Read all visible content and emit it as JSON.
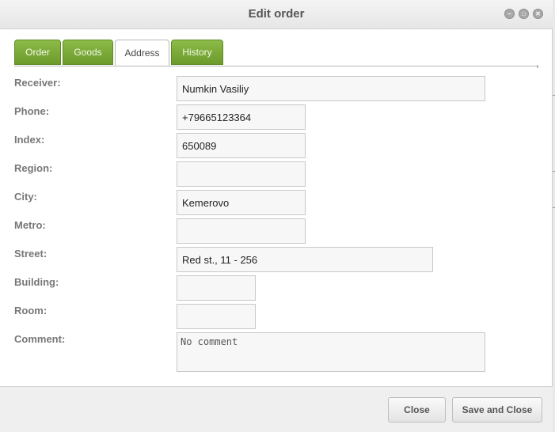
{
  "dialog": {
    "title": "Edit order",
    "window_buttons": {
      "minimize": "–",
      "maximize": "□",
      "close": "✕"
    }
  },
  "tabs": [
    {
      "label": "Order",
      "active": false
    },
    {
      "label": "Goods",
      "active": false
    },
    {
      "label": "Address",
      "active": true
    },
    {
      "label": "History",
      "active": false
    }
  ],
  "form": {
    "receiver": {
      "label": "Receiver:",
      "value": "Numkin Vasiliy"
    },
    "phone": {
      "label": "Phone:",
      "value": "+79665123364"
    },
    "index": {
      "label": "Index:",
      "value": "650089"
    },
    "region": {
      "label": "Region:",
      "value": ""
    },
    "city": {
      "label": "City:",
      "value": "Kemerovo"
    },
    "metro": {
      "label": "Metro:",
      "value": ""
    },
    "street": {
      "label": "Street:",
      "value": "Red st., 11 - 256"
    },
    "building": {
      "label": "Building:",
      "value": ""
    },
    "room": {
      "label": "Room:",
      "value": ""
    },
    "comment": {
      "label": "Comment:",
      "value": "No comment"
    }
  },
  "footer": {
    "close_label": "Close",
    "save_close_label": "Save and Close"
  },
  "colors": {
    "tab_green": "#7aa838",
    "title_text": "#555555"
  }
}
